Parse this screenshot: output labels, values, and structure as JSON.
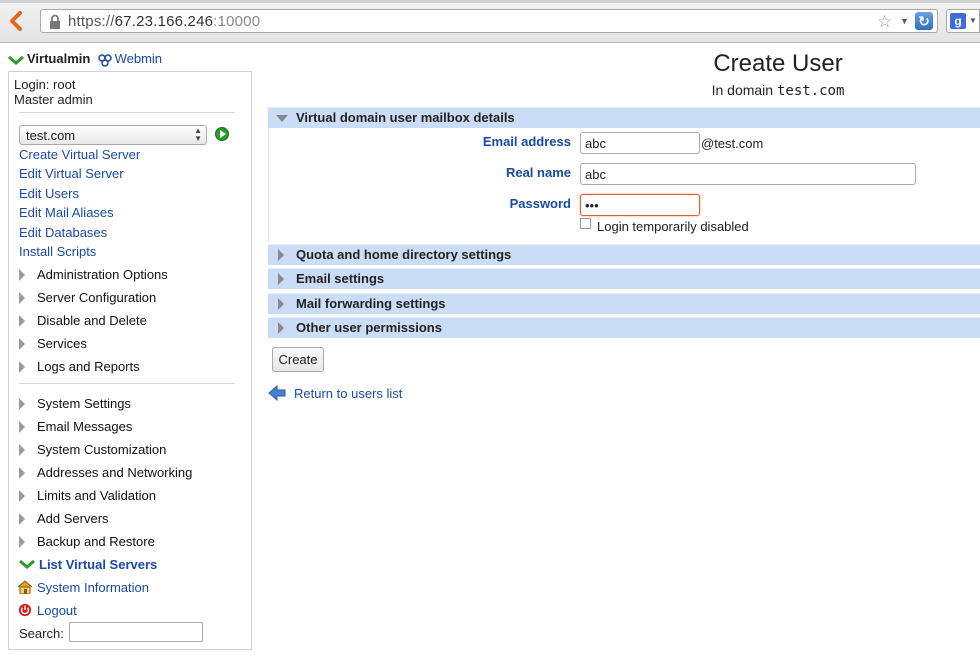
{
  "browser": {
    "url_scheme": "https://",
    "url_host": "67.23.166.246",
    "url_port": ":10000"
  },
  "brand": {
    "virtualmin": "Virtualmin",
    "webmin": "Webmin"
  },
  "sidebar": {
    "login_line": "Login: root",
    "role_line": "Master admin",
    "domain_selected": "test.com",
    "links": [
      "Create Virtual Server",
      "Edit Virtual Server",
      "Edit Users",
      "Edit Mail Aliases",
      "Edit Databases",
      "Install Scripts"
    ],
    "categories_1": [
      "Administration Options",
      "Server Configuration",
      "Disable and Delete",
      "Services",
      "Logs and Reports"
    ],
    "categories_2": [
      "System Settings",
      "Email Messages",
      "System Customization",
      "Addresses and Networking",
      "Limits and Validation",
      "Add Servers",
      "Backup and Restore"
    ],
    "list_virtual_servers": "List Virtual Servers",
    "system_information": "System Information",
    "logout": "Logout",
    "search_label": "Search:"
  },
  "main": {
    "title": "Create User",
    "subtitle_prefix": "In domain",
    "subtitle_domain": "test.com",
    "sections": [
      "Virtual domain user mailbox details",
      "Quota and home directory settings",
      "Email settings",
      "Mail forwarding settings",
      "Other user permissions"
    ],
    "email_label": "Email address",
    "email_value": "abc",
    "email_suffix": "@test.com",
    "realname_label": "Real name",
    "realname_value": "abc",
    "password_label": "Password",
    "password_value": "•••",
    "disabled_label": "Login temporarily disabled",
    "create_button": "Create",
    "return_link": "Return to users list"
  }
}
